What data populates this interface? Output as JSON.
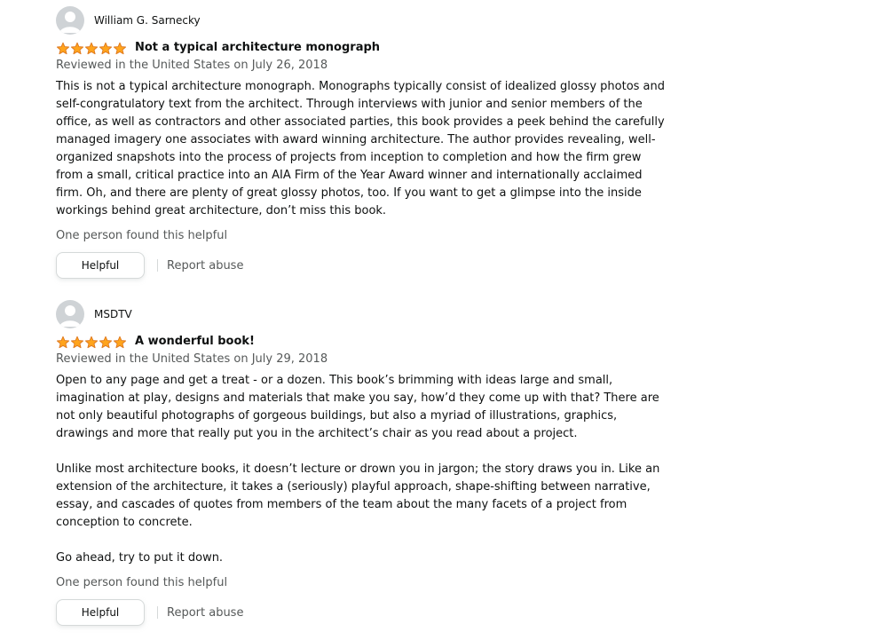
{
  "reviews": [
    {
      "profile_name": "William G. Sarnecky",
      "rating": 5,
      "rating_max": 5,
      "title": "Not a typical architecture monograph",
      "date": "Reviewed in the United States on July 26, 2018",
      "body": [
        "This is not a typical architecture monograph. Monographs typically consist of idealized glossy photos and self-congratulatory text from the architect. Through interviews with junior and senior members of the office, as well as contractors and other associated parties, this book provides a peek behind the carefully managed imagery one associates with award winning architecture. The author provides revealing, well-organized snapshots into the process of projects from inception to completion and how the firm grew from a small, critical practice into an AIA Firm of the Year Award winner and internationally acclaimed firm. Oh, and there are plenty of great glossy photos, too. If you want to get a glimpse into the inside workings behind great architecture, don’t miss this book."
      ],
      "helpful_count": "One person found this helpful",
      "helpful_label": "Helpful",
      "report_label": "Report abuse"
    },
    {
      "profile_name": "MSDTV",
      "rating": 5,
      "rating_max": 5,
      "title": "A wonderful book!",
      "date": "Reviewed in the United States on July 29, 2018",
      "body": [
        "Open to any page and get a treat - or a dozen. This book’s brimming with ideas large and small, imagination at play, designs and materials that make you say, how’d they come up with that? There are not only beautiful photographs of gorgeous buildings, but also a myriad of illustrations, graphics, drawings and more that really put you in the architect’s chair as you read about a project.",
        "Unlike most architecture books, it doesn’t lecture or drown you in jargon; the story draws you in. Like an extension of the architecture, it takes a (seriously) playful approach, shape-shifting between narrative, essay, and cascades of quotes from members of the team about the many facets of a project from conception to concrete.",
        "Go ahead, try to put it down."
      ],
      "helpful_count": "One person found this helpful",
      "helpful_label": "Helpful",
      "report_label": "Report abuse"
    }
  ],
  "icons": {
    "avatar": "default-avatar-icon",
    "star": "star-icon"
  },
  "colors": {
    "star_fill": "#ffa41c",
    "star_stroke": "#de7921",
    "secondary_text": "#565959",
    "primary_text": "#0f1111",
    "avatar_bg": "#cfd3d6",
    "button_border": "#d5d9d9"
  }
}
